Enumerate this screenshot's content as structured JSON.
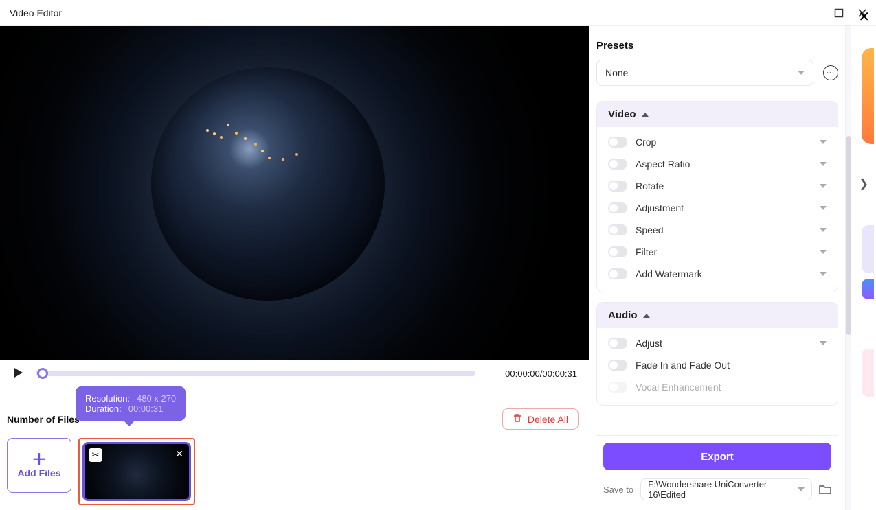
{
  "titlebar": {
    "title": "Video Editor"
  },
  "preview": {
    "time_current": "00:00:00",
    "time_total": "00:00:31"
  },
  "tooltip": {
    "res_label": "Resolution:",
    "res_value": "480 x 270",
    "dur_label": "Duration:",
    "dur_value": "00:00:31"
  },
  "files": {
    "count_label": "Number of Files",
    "delete_all": "Delete All",
    "add_files": "Add Files"
  },
  "panel": {
    "presets_title": "Presets",
    "preset_selected": "None",
    "sections": {
      "video": {
        "title": "Video",
        "options": [
          "Crop",
          "Aspect Ratio",
          "Rotate",
          "Adjustment",
          "Speed",
          "Filter",
          "Add Watermark"
        ]
      },
      "audio": {
        "title": "Audio",
        "options": [
          "Adjust",
          "Fade In and Fade Out",
          "Vocal Enhancement"
        ]
      }
    },
    "export": "Export",
    "save_to_label": "Save to",
    "save_path": "F:\\Wondershare UniConverter 16\\Edited"
  }
}
